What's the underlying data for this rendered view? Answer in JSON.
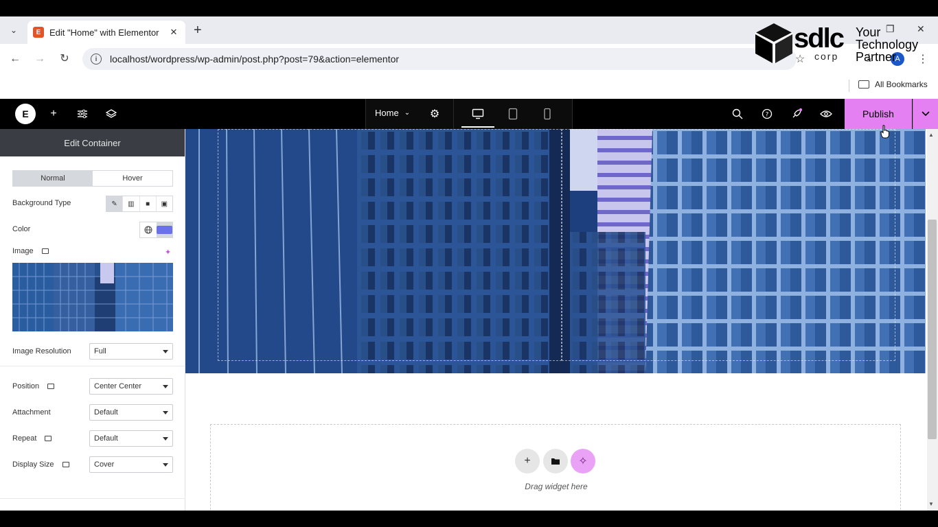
{
  "browser": {
    "tab_title": "Edit \"Home\" with Elementor",
    "tab_favicon": "E",
    "new_tab_label": "+",
    "tab_close": "✕",
    "url": "localhost/wordpress/wp-admin/post.php?post=79&action=elementor",
    "avatar_initial": "A",
    "bookmarks_label": "All Bookmarks"
  },
  "watermark": {
    "brand": "sdlc",
    "corp": "corp",
    "tagline": "Your Technology Partner"
  },
  "editor": {
    "logo_glyph": "E",
    "page_name": "Home",
    "publish_label": "Publish",
    "accent_color": "#e580f2"
  },
  "panel": {
    "title": "Edit Container",
    "state_tabs": [
      "Normal",
      "Hover"
    ],
    "background_type_label": "Background Type",
    "color_label": "Color",
    "color_value": "#6b72e8",
    "image_label": "Image",
    "image_resolution_label": "Image Resolution",
    "image_resolution_value": "Full",
    "position_label": "Position",
    "position_value": "Center Center",
    "attachment_label": "Attachment",
    "attachment_value": "Default",
    "repeat_label": "Repeat",
    "repeat_value": "Default",
    "display_size_label": "Display Size",
    "display_size_value": "Cover"
  },
  "canvas": {
    "drag_text": "Drag widget here"
  }
}
